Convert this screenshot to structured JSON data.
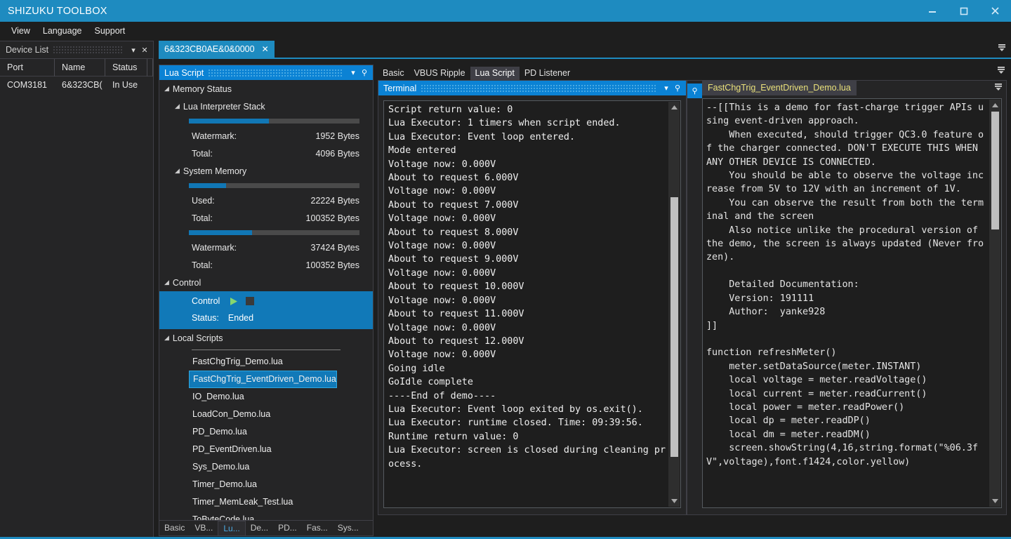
{
  "window": {
    "title": "SHIZUKU TOOLBOX",
    "minimize_icon": "minimize-icon",
    "maximize_icon": "maximize-icon",
    "close_icon": "close-icon",
    "accent_color": "#1e8bc0"
  },
  "menubar": {
    "items": [
      {
        "label": "View"
      },
      {
        "label": "Language"
      },
      {
        "label": "Support"
      }
    ]
  },
  "device_panel": {
    "title": "Device List",
    "dropdown_icon": "chevron-down-icon",
    "close_icon": "close-icon",
    "columns": [
      "Port",
      "Name",
      "Status"
    ],
    "rows": [
      {
        "port": "COM3181",
        "name": "6&323CB(",
        "status": "In Use"
      }
    ]
  },
  "document_tabs": {
    "tabs": [
      {
        "label": "6&323CB0AE&0&0000",
        "close_icon": "close-icon",
        "active": true
      }
    ],
    "overflow_icon": "overflow-chevron-icon"
  },
  "lua_dock": {
    "title": "Lua Script",
    "dropdown_icon": "chevron-down-icon",
    "pin_icon": "pin-icon",
    "memory_status": {
      "label": "Memory Status",
      "lua_interpreter_stack": {
        "label": "Lua Interpreter Stack",
        "progress_percent": 47,
        "rows": [
          {
            "key": "Watermark:",
            "value": "1952 Bytes"
          },
          {
            "key": "Total:",
            "value": "4096 Bytes"
          }
        ]
      },
      "system_memory": {
        "label": "System Memory",
        "used_progress_percent": 22,
        "watermark_progress_percent": 37,
        "used_rows": [
          {
            "key": "Used:",
            "value": "22224 Bytes"
          },
          {
            "key": "Total:",
            "value": "100352 Bytes"
          }
        ],
        "watermark_rows": [
          {
            "key": "Watermark:",
            "value": "37424 Bytes"
          },
          {
            "key": "Total:",
            "value": "100352 Bytes"
          }
        ]
      }
    },
    "control": {
      "label": "Control",
      "section_label": "Control",
      "play_icon": "play-icon",
      "stop_icon": "stop-icon",
      "status_label": "Status:",
      "status_value": "Ended"
    },
    "local_scripts": {
      "label": "Local Scripts",
      "items": [
        {
          "name": "FastChgTrig_Demo.lua",
          "selected": false
        },
        {
          "name": "FastChgTrig_EventDriven_Demo.lua",
          "selected": true
        },
        {
          "name": "IO_Demo.lua",
          "selected": false
        },
        {
          "name": "LoadCon_Demo.lua",
          "selected": false
        },
        {
          "name": "PD_Demo.lua",
          "selected": false
        },
        {
          "name": "PD_EventDriven.lua",
          "selected": false
        },
        {
          "name": "Sys_Demo.lua",
          "selected": false
        },
        {
          "name": "Timer_Demo.lua",
          "selected": false
        },
        {
          "name": "Timer_MemLeak_Test.lua",
          "selected": false
        },
        {
          "name": "ToByteCode.lua",
          "selected": false
        }
      ]
    },
    "mini_tabs": [
      {
        "label": "Basic",
        "active": false
      },
      {
        "label": "VB...",
        "active": false
      },
      {
        "label": "Lu...",
        "active": true
      },
      {
        "label": "De...",
        "active": false
      },
      {
        "label": "PD...",
        "active": false
      },
      {
        "label": "Fas...",
        "active": false
      },
      {
        "label": "Sys...",
        "active": false
      }
    ]
  },
  "inner_tabs": {
    "tabs": [
      {
        "label": "Basic",
        "active": false
      },
      {
        "label": "VBUS Ripple",
        "active": false
      },
      {
        "label": "Lua Script",
        "active": true
      },
      {
        "label": "PD Listener",
        "active": false
      }
    ],
    "overflow_icon": "overflow-chevron-icon"
  },
  "terminal": {
    "title": "Terminal",
    "dropdown_icon": "chevron-down-icon",
    "pin_icon": "pin-icon",
    "text": "Script return value: 0\nLua Executor: 1 timers when script ended.\nLua Executor: Event loop entered.\nMode entered\nVoltage now: 0.000V\nAbout to request 6.000V\nVoltage now: 0.000V\nAbout to request 7.000V\nVoltage now: 0.000V\nAbout to request 8.000V\nVoltage now: 0.000V\nAbout to request 9.000V\nVoltage now: 0.000V\nAbout to request 10.000V\nVoltage now: 0.000V\nAbout to request 11.000V\nVoltage now: 0.000V\nAbout to request 12.000V\nVoltage now: 0.000V\nGoing idle\nGoIdle complete\n----End of demo----\nLua Executor: Event loop exited by os.exit().\nLua Executor: runtime closed. Time: 09:39:56.\nRuntime return value: 0\nLua Executor: screen is closed during cleaning process.",
    "scroll_up_icon": "scroll-up-arrow-icon",
    "scroll_down_icon": "scroll-down-arrow-icon"
  },
  "editor": {
    "pin_icon": "pin-icon",
    "filename": "FastChgTrig_EventDriven_Demo.lua",
    "overflow_icon": "overflow-chevron-icon",
    "code": "--[[This is a demo for fast-charge trigger APIs using event-driven approach.\n    When executed, should trigger QC3.0 feature of the charger connected. DON'T EXECUTE THIS WHEN ANY OTHER DEVICE IS CONNECTED.\n    You should be able to observe the voltage increase from 5V to 12V with an increment of 1V.\n    You can observe the result from both the terminal and the screen\n    Also notice unlike the procedural version of the demo, the screen is always updated (Never frozen).\n\n    Detailed Documentation:\n    Version: 191111\n    Author:  yanke928\n]]\n\nfunction refreshMeter()\n    meter.setDataSource(meter.INSTANT)\n    local voltage = meter.readVoltage()\n    local current = meter.readCurrent()\n    local power = meter.readPower()\n    local dp = meter.readDP()\n    local dm = meter.readDM()\n    screen.showString(4,16,string.format(\"%06.3fV\",voltage),font.f1424,color.yellow)",
    "scroll_up_icon": "scroll-up-arrow-icon",
    "scroll_down_icon": "scroll-down-arrow-icon"
  }
}
